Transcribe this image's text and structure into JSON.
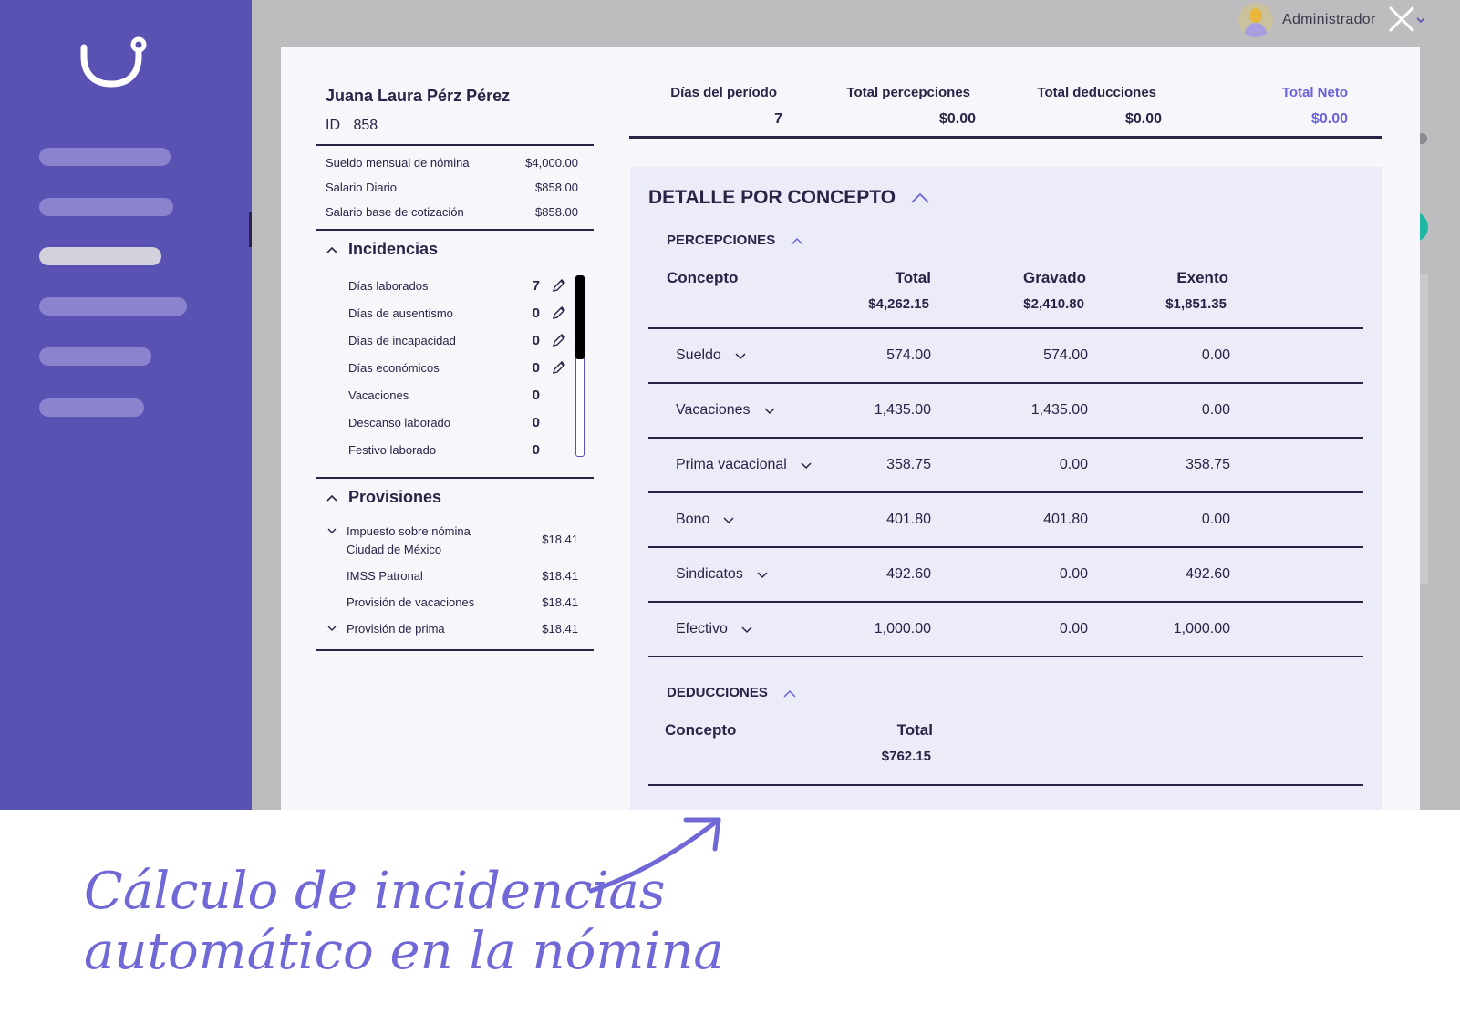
{
  "topbar": {
    "user_name": "Administrador"
  },
  "employee": {
    "name": "Juana Laura Pérz Pérez",
    "id_label": "ID",
    "id_value": "858",
    "salary_rows": [
      {
        "label": "Sueldo mensual de nómina",
        "value": "$4,000.00"
      },
      {
        "label": "Salario Diario",
        "value": "$858.00"
      },
      {
        "label": "Salario base de cotización",
        "value": "$858.00"
      }
    ]
  },
  "incidencias": {
    "title": "Incidencias",
    "rows": [
      {
        "label": "Días laborados",
        "value": "7"
      },
      {
        "label": "Días de ausentismo",
        "value": "0"
      },
      {
        "label": "Días de incapacidad",
        "value": "0"
      },
      {
        "label": "Días económicos",
        "value": "0"
      },
      {
        "label": "Vacaciones",
        "value": "0"
      },
      {
        "label": "Descanso laborado",
        "value": "0"
      },
      {
        "label": "Festivo laborado",
        "value": "0"
      }
    ]
  },
  "provisiones": {
    "title": "Provisiones",
    "rows": [
      {
        "label_line1": "Impuesto sobre nómina",
        "label_line2": "Ciudad de México",
        "value": "$18.41"
      },
      {
        "label_line1": "IMSS Patronal",
        "value": "$18.41"
      },
      {
        "label_line1": "Provisión de vacaciones",
        "value": "$18.41"
      },
      {
        "label_line1": "Provisión de prima",
        "value": "$18.41"
      }
    ]
  },
  "summary": {
    "dias_label": "Días del período",
    "dias_value": "7",
    "percepciones_label": "Total percepciones",
    "percepciones_value": "$0.00",
    "deducciones_label": "Total deducciones",
    "deducciones_value": "$0.00",
    "neto_label": "Total Neto",
    "neto_value": "$0.00"
  },
  "detail": {
    "title": "DETALLE POR CONCEPTO",
    "percepciones": {
      "title": "PERCEPCIONES",
      "headers": {
        "concepto": "Concepto",
        "total": "Total",
        "gravado": "Gravado",
        "exento": "Exento"
      },
      "totals": {
        "total": "$4,262.15",
        "gravado": "$2,410.80",
        "exento": "$1,851.35"
      },
      "rows": [
        {
          "concepto": "Sueldo",
          "total": "574.00",
          "gravado": "574.00",
          "exento": "0.00"
        },
        {
          "concepto": "Vacaciones",
          "total": "1,435.00",
          "gravado": "1,435.00",
          "exento": "0.00"
        },
        {
          "concepto": "Prima vacacional",
          "total": "358.75",
          "gravado": "0.00",
          "exento": "358.75"
        },
        {
          "concepto": "Bono",
          "total": "401.80",
          "gravado": "401.80",
          "exento": "0.00"
        },
        {
          "concepto": "Sindicatos",
          "total": "492.60",
          "gravado": "0.00",
          "exento": "492.60"
        },
        {
          "concepto": "Efectivo",
          "total": "1,000.00",
          "gravado": "0.00",
          "exento": "1,000.00"
        }
      ]
    },
    "deducciones": {
      "title": "DEDUCCIONES",
      "headers": {
        "concepto": "Concepto",
        "total": "Total"
      },
      "totals": {
        "total": "$762.15"
      }
    }
  },
  "caption": {
    "line1": "Cálculo de incidencias",
    "line2": "automático en la nómina"
  },
  "colors": {
    "sidebar": "#5a52b3",
    "accent": "#6b63d8",
    "ink": "#2a2346",
    "panel": "#ececf9",
    "teal": "#1fb5a3"
  }
}
